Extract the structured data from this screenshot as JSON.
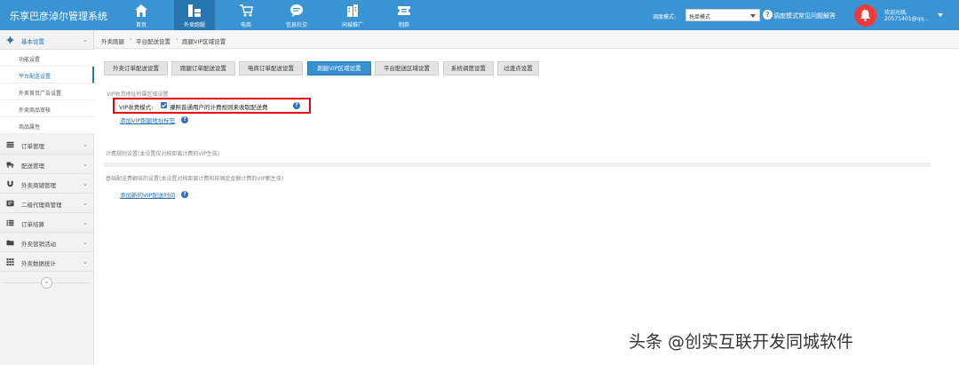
{
  "app": {
    "title": "乐享巴彦淖尔管理系统"
  },
  "nav": [
    {
      "label": "首页",
      "icon": "home-icon"
    },
    {
      "label": "外卖跑腿",
      "icon": "runner-icon"
    },
    {
      "label": "电商",
      "icon": "cart-icon"
    },
    {
      "label": "信息社交",
      "icon": "chat-icon"
    },
    {
      "label": "同城推广",
      "icon": "building-icon"
    },
    {
      "label": "制券",
      "icon": "ticket-icon"
    }
  ],
  "header": {
    "mode_label": "调度模式:",
    "mode_value": "抢单模式",
    "help_link": "调度模式常见问题解答",
    "user_greeting": "欢迎光临,",
    "user_name": "20571401@qq..."
  },
  "sidebar": {
    "groups": [
      {
        "label": "基本设置",
        "icon": "gear-icon",
        "expanded": true
      },
      {
        "label": "订单管理",
        "icon": "order-icon"
      },
      {
        "label": "配送管理",
        "icon": "truck-icon"
      },
      {
        "label": "外卖商铺管理",
        "icon": "magnet-icon"
      },
      {
        "label": "二级代理商管理",
        "icon": "agent-icon"
      },
      {
        "label": "订单结算",
        "icon": "list-icon"
      },
      {
        "label": "外卖营销活动",
        "icon": "folder-icon"
      },
      {
        "label": "外卖数据统计",
        "icon": "grid-icon"
      }
    ],
    "sub_items": [
      "功能设置",
      "平台配送设置",
      "外卖首页广告设置",
      "外卖商品审核",
      "商品属性"
    ],
    "active_sub": "平台配送设置"
  },
  "breadcrumb": [
    "外卖跑腿",
    "平台配送设置",
    "跑腿VIP区域设置"
  ],
  "tabs": [
    {
      "label": "外卖订单配送设置"
    },
    {
      "label": "跑腿订单配送设置"
    },
    {
      "label": "电商订单配送设置"
    },
    {
      "label": "跑腿VIP区域设置",
      "active": true
    },
    {
      "label": "平台配送区域设置"
    },
    {
      "label": "系统调度设置"
    },
    {
      "label": "过渡点设置"
    }
  ],
  "content": {
    "section1_title": "VIP收货地址所属区域设置",
    "vip_mode_label": "VIP收费模式:",
    "vip_mode_checked": true,
    "vip_mode_text": "遵照普通用户的计费规则来收取配送费",
    "add_vip_tag_link": "添加VIP跑腿地址标签",
    "section2_title": "计费规则设置(本设置仅对按距离计费的VIP生效)",
    "section3_title": "基础配送费翻倍的设置(本设置对按距离计费和按固定金额计费的VIP都生效)",
    "add_vip_time_link": "添加新的VIP配送时间"
  },
  "watermark": "头条 @创实互联开发同城软件",
  "colors": {
    "topbar": "#3a94d3",
    "nav_active": "#2775b0",
    "tab_active": "#3a8fd1",
    "highlight_border": "#e60012",
    "bell": "#ee3a3a"
  }
}
